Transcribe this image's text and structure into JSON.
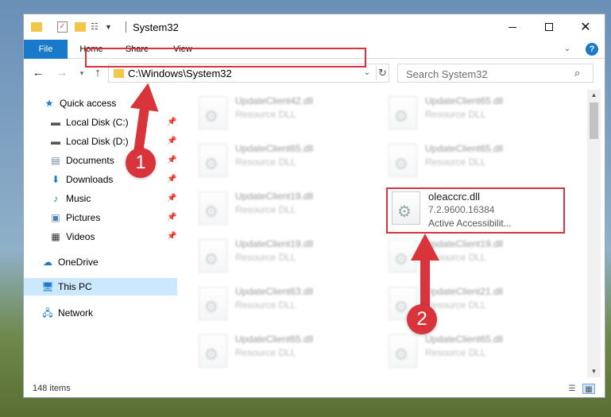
{
  "window": {
    "title": "System32",
    "controls": {
      "minimize": "minimize",
      "maximize": "maximize",
      "close": "✕"
    }
  },
  "ribbon": {
    "tabs": [
      "File",
      "Home",
      "Share",
      "View"
    ],
    "help": "?"
  },
  "navigation": {
    "address": "C:\\Windows\\System32",
    "search_placeholder": "Search System32"
  },
  "sidebar": {
    "items": [
      {
        "label": "Quick access",
        "icon": "star-icon",
        "pinned": false
      },
      {
        "label": "Local Disk (C:)",
        "icon": "drive-icon",
        "pinned": true
      },
      {
        "label": "Local Disk (D:)",
        "icon": "drive-icon",
        "pinned": true
      },
      {
        "label": "Documents",
        "icon": "documents-icon",
        "pinned": true
      },
      {
        "label": "Downloads",
        "icon": "download-icon",
        "pinned": true
      },
      {
        "label": "Music",
        "icon": "music-icon",
        "pinned": true
      },
      {
        "label": "Pictures",
        "icon": "pictures-icon",
        "pinned": true
      },
      {
        "label": "Videos",
        "icon": "videos-icon",
        "pinned": true
      },
      {
        "label": "OneDrive",
        "icon": "cloud-icon",
        "pinned": false
      },
      {
        "label": "This PC",
        "icon": "computer-icon",
        "pinned": false,
        "selected": true
      },
      {
        "label": "Network",
        "icon": "network-icon",
        "pinned": false
      }
    ]
  },
  "files": {
    "left_column": [
      {
        "name": "UpdateClient42.dll",
        "desc": "Resource DLL"
      },
      {
        "name": "UpdateClient65.dll",
        "desc": "Resource DLL"
      },
      {
        "name": "UpdateClient19.dll",
        "desc": "Resource DLL"
      },
      {
        "name": "UpdateClient19.dll",
        "desc": "Resource DLL"
      },
      {
        "name": "UpdateClient63.dll",
        "desc": "Resource DLL"
      },
      {
        "name": "UpdateClient65.dll",
        "desc": "Resource DLL"
      }
    ],
    "right_column": [
      {
        "name": "UpdateClient65.dll",
        "desc": "Resource DLL"
      },
      {
        "name": "UpdateClient65.dll",
        "desc": "Resource DLL"
      },
      {
        "name": "oleaccrc.dll",
        "version": "7.2.9600.16384",
        "desc": "Active Accessibilit...",
        "highlighted": true
      },
      {
        "name": "UpdateClient19.dll",
        "desc": "Resource DLL"
      },
      {
        "name": "UpdateClient21.dll",
        "desc": "Resource DLL"
      },
      {
        "name": "UpdateClient65.dll",
        "desc": "Resource DLL"
      }
    ]
  },
  "status": {
    "item_count": "148 items"
  },
  "callouts": [
    {
      "number": "1",
      "color": "#d9333b"
    },
    {
      "number": "2",
      "color": "#d9333b"
    }
  ],
  "colors": {
    "accent": "#1979ca",
    "highlight": "#d9333b",
    "selected": "#cce8ff"
  }
}
